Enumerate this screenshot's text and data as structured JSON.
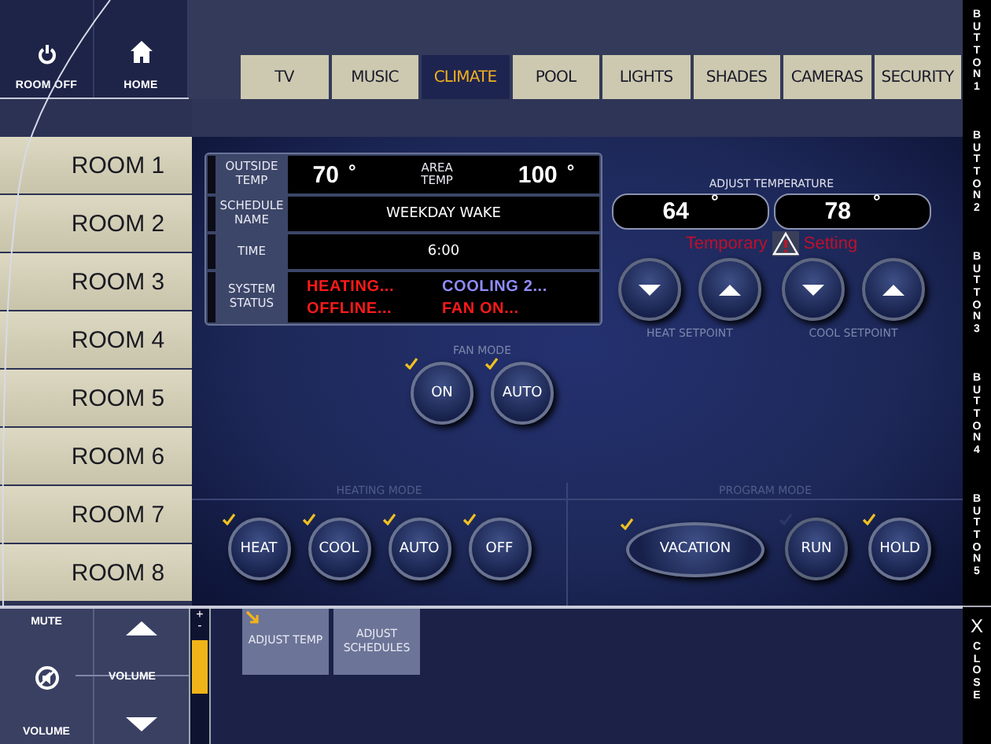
{
  "top_buttons": [
    {
      "label": "ROOM OFF",
      "kind": "power"
    },
    {
      "label": "HOME",
      "kind": "home"
    }
  ],
  "tabs": [
    {
      "label": "TV",
      "selected": false
    },
    {
      "label": "MUSIC",
      "selected": false
    },
    {
      "label": "CLIMATE",
      "selected": true
    },
    {
      "label": "POOL",
      "selected": false
    },
    {
      "label": "LIGHTS",
      "selected": false
    },
    {
      "label": "SHADES",
      "selected": false
    },
    {
      "label": "CAMERAS",
      "selected": false
    },
    {
      "label": "SECURITY",
      "selected": false
    }
  ],
  "rooms": [
    "ROOM 1",
    "ROOM 2",
    "ROOM 3",
    "ROOM 4",
    "ROOM 5",
    "ROOM 6",
    "ROOM 7",
    "ROOM 8"
  ],
  "climate": {
    "info": {
      "outside_temp": {
        "label": "OUTSIDE TEMP",
        "value": "70",
        "degree": "°"
      },
      "area_temp": {
        "label": "AREA TEMP",
        "value": "100",
        "degree": "°"
      },
      "schedule": {
        "label": "SCHEDULE NAME",
        "value": "WEEKDAY WAKE"
      },
      "time": {
        "label": "TIME",
        "value": "6:00"
      },
      "system_status": {
        "label": "SYSTEM STATUS",
        "items": [
          {
            "text": "HEATING...",
            "color": "#ff1a1a"
          },
          {
            "text": "COOLING 2...",
            "color": "#8f8cff"
          },
          {
            "text": "OFFLINE...",
            "color": "#ff1a1a"
          },
          {
            "text": "FAN ON...",
            "color": "#ff1a1a"
          }
        ]
      }
    },
    "adjust_temperature": {
      "title": "ADJUST TEMPERATURE",
      "heat": {
        "value": "64",
        "degree": "°"
      },
      "cool": {
        "value": "78",
        "degree": "°"
      },
      "notice_left": "Temporary",
      "notice_right": "Setting",
      "setpoints": [
        {
          "label": "HEAT SETPOINT"
        },
        {
          "label": "COOL SETPOINT"
        }
      ]
    },
    "fan_mode": {
      "title": "FAN MODE",
      "buttons": [
        {
          "label": "ON",
          "checked": true,
          "kind": "round"
        },
        {
          "label": "AUTO",
          "checked": true,
          "kind": "round"
        }
      ]
    },
    "heating_mode": {
      "title": "HEATING MODE",
      "buttons": [
        {
          "label": "HEAT",
          "checked": true,
          "kind": "round"
        },
        {
          "label": "COOL",
          "checked": true,
          "kind": "round"
        },
        {
          "label": "AUTO",
          "checked": true,
          "kind": "round"
        },
        {
          "label": "OFF",
          "checked": true,
          "kind": "round"
        }
      ]
    },
    "program_mode": {
      "title": "PROGRAM MODE",
      "buttons": [
        {
          "label": "VACATION",
          "checked": true,
          "kind": "wide"
        },
        {
          "label": "RUN",
          "checked": false,
          "kind": "round"
        },
        {
          "label": "HOLD",
          "checked": true,
          "kind": "round"
        }
      ]
    }
  },
  "bottom": {
    "mute_label": "MUTE",
    "volume_label": "VOLUME",
    "volume_center": "VOLUME",
    "slider_plus": "+",
    "slider_minus": "-",
    "actions": [
      "ADJUST TEMP",
      "ADJUST SCHEDULES"
    ]
  },
  "side_buttons": [
    "BUTTON1",
    "BUTTON2",
    "BUTTON3",
    "BUTTON4",
    "BUTTON5"
  ],
  "close": {
    "icon": "X",
    "label": "CLOSE"
  }
}
